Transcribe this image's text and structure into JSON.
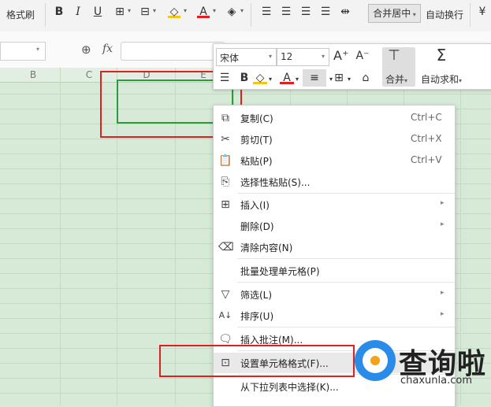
{
  "ribbon": {
    "format_painter": "格式刷",
    "merge_center": "合并居中",
    "auto_wrap": "自动换行",
    "icons": [
      "bold-icon",
      "italic-icon",
      "underline-icon",
      "border-icon",
      "fill-color-icon",
      "font-color-icon",
      "clear-icon",
      "align-left-icon",
      "align-center-icon",
      "align-right-icon",
      "justify-icon",
      "distribute-icon"
    ],
    "font_color": "#e02020",
    "fill_color": "#f5c518"
  },
  "formula_bar": {
    "fx": "fx",
    "formula_value": ""
  },
  "columns": [
    "B",
    "C",
    "D",
    "E"
  ],
  "mini_toolbar": {
    "font_name": "宋体",
    "font_size": "12",
    "merge_label": "合并",
    "autosum_label": "自动求和"
  },
  "context_menu": {
    "items": [
      {
        "label": "复制(C)",
        "shortcut": "Ctrl+C",
        "icon": "copy-icon"
      },
      {
        "label": "剪切(T)",
        "shortcut": "Ctrl+X",
        "icon": "scissors-icon"
      },
      {
        "label": "粘贴(P)",
        "shortcut": "Ctrl+V",
        "icon": "paste-icon"
      },
      {
        "label": "选择性粘贴(S)...",
        "shortcut": "",
        "icon": "paste-special-icon"
      },
      {
        "label": "插入(I)",
        "shortcut": "",
        "icon": "insert-icon"
      },
      {
        "label": "删除(D)",
        "shortcut": "",
        "icon": ""
      },
      {
        "label": "清除内容(N)",
        "shortcut": "",
        "icon": "eraser-icon"
      },
      {
        "label": "批量处理单元格(P)",
        "shortcut": "",
        "icon": ""
      },
      {
        "label": "筛选(L)",
        "shortcut": "",
        "icon": "filter-icon"
      },
      {
        "label": "排序(U)",
        "shortcut": "",
        "icon": "sort-icon"
      },
      {
        "label": "插入批注(M)...",
        "shortcut": "",
        "icon": "comment-icon"
      },
      {
        "label": "设置单元格格式(F)...",
        "shortcut": "",
        "icon": "format-cells-icon"
      },
      {
        "label": "从下拉列表中选择(K)...",
        "shortcut": "",
        "icon": ""
      }
    ]
  },
  "watermark": {
    "title": "查询啦",
    "url": "chaxunla.com"
  },
  "colors": {
    "sheet_bg": "#d7ead8",
    "selection": "#2f9a3c",
    "highlight_box": "#e02020",
    "watermark_blue": "#2a8be8"
  }
}
